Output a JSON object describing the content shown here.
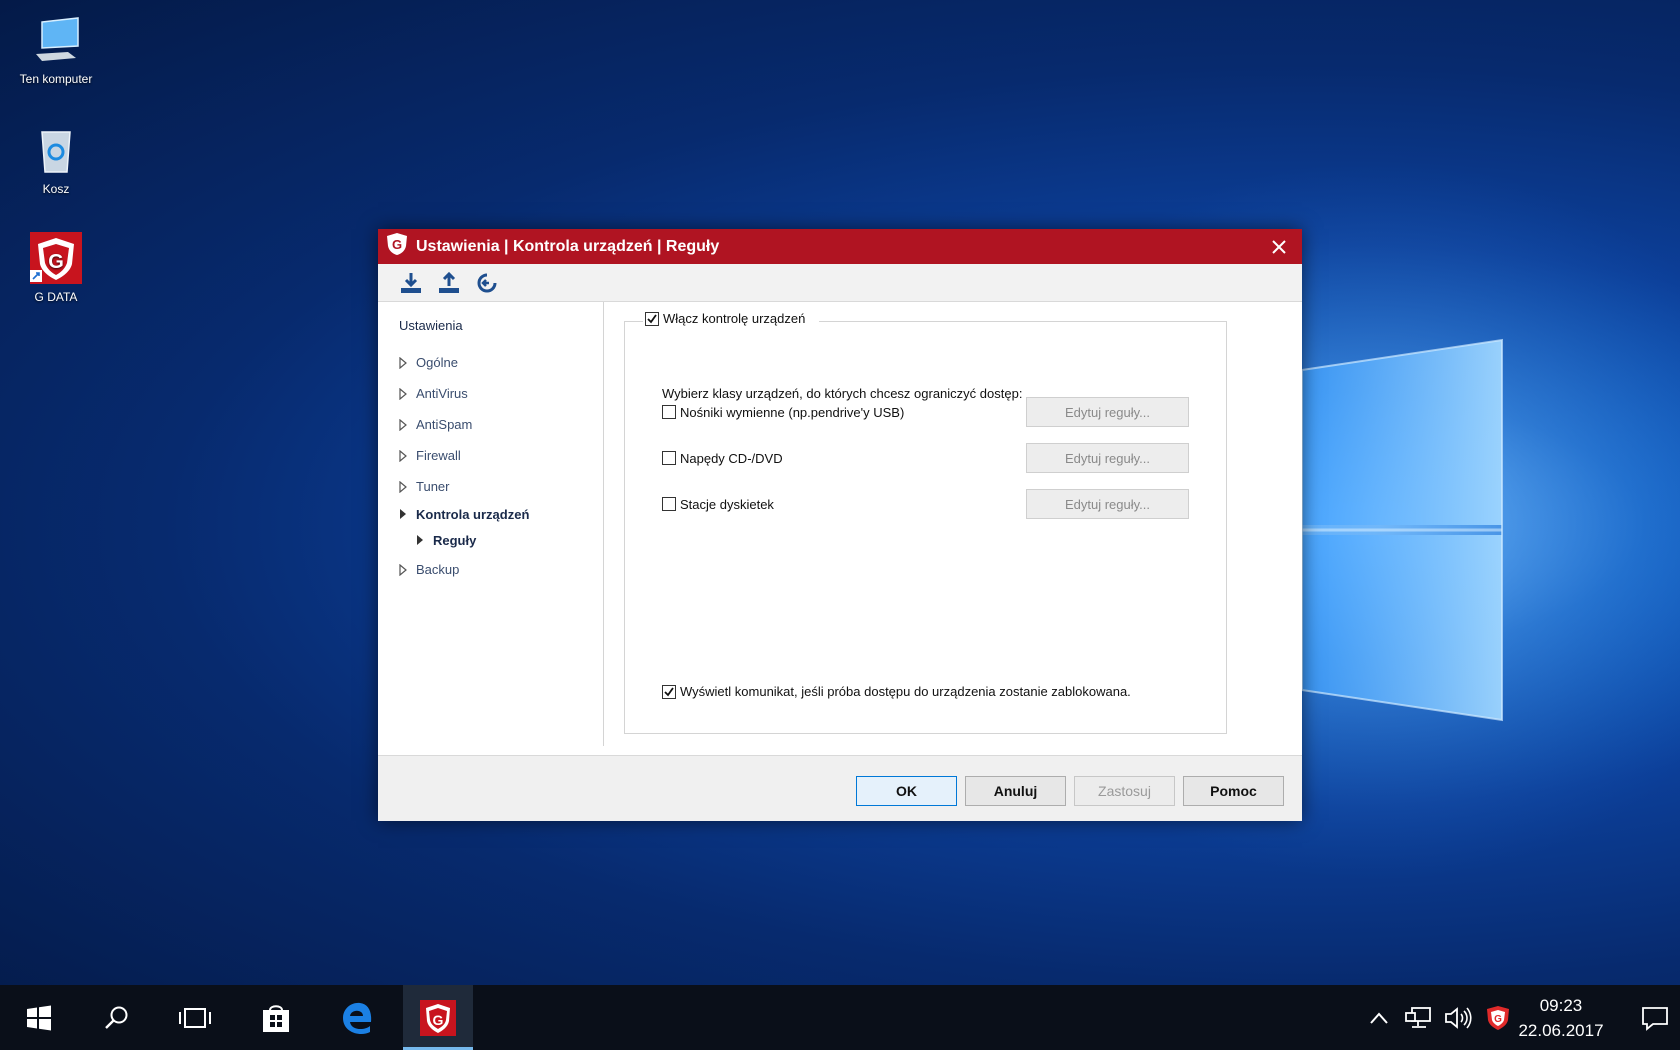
{
  "desktop": {
    "icons": [
      {
        "label": "Ten komputer",
        "icon": "computer-icon"
      },
      {
        "label": "Kosz",
        "icon": "recycle-bin-icon"
      },
      {
        "label": "G DATA",
        "icon": "gdata-shield-icon"
      }
    ]
  },
  "window": {
    "title": "Ustawienia | Kontrola urządzeń | Reguły",
    "accent": "#b01422",
    "toolbar": [
      "download-icon",
      "upload-icon",
      "reset-icon"
    ]
  },
  "nav": {
    "heading": "Ustawienia",
    "items": [
      {
        "label": "Ogólne",
        "active": false
      },
      {
        "label": "AntiVirus",
        "active": false
      },
      {
        "label": "AntiSpam",
        "active": false
      },
      {
        "label": "Firewall",
        "active": false
      },
      {
        "label": "Tuner",
        "active": false
      },
      {
        "label": "Kontrola urządzeń",
        "active": true
      },
      {
        "label": "Reguły",
        "sub": true
      },
      {
        "label": "Backup",
        "active": false
      }
    ]
  },
  "panel": {
    "enable_label": "Włącz kontrolę urządzeń",
    "enable_checked": true,
    "description": "Wybierz klasy urządzeń, do których chcesz ograniczyć dostęp:",
    "rows": [
      {
        "label": "Nośniki wymienne (np.pendrive'y USB)",
        "checked": false,
        "button": "Edytuj reguły..."
      },
      {
        "label": "Napędy CD-/DVD",
        "checked": false,
        "button": "Edytuj reguły..."
      },
      {
        "label": "Stacje dyskietek",
        "checked": false,
        "button": "Edytuj reguły..."
      }
    ],
    "notify_label": "Wyświetl komunikat, jeśli próba dostępu do urządzenia zostanie zablokowana.",
    "notify_checked": true
  },
  "footer": {
    "ok": "OK",
    "cancel": "Anuluj",
    "apply": "Zastosuj",
    "help": "Pomoc"
  },
  "taskbar": {
    "time": "09:23",
    "date": "22.06.2017"
  }
}
